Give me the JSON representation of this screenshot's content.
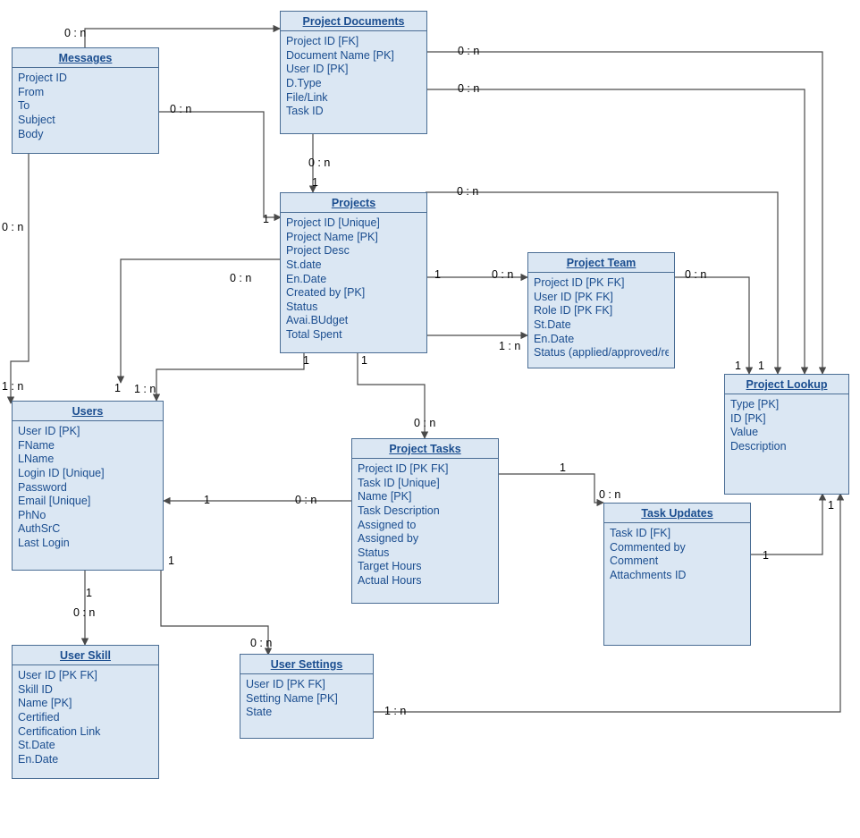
{
  "entities": {
    "messages": {
      "title": "Messages",
      "attrs": [
        "Project ID",
        "From",
        "To",
        "Subject",
        "Body"
      ]
    },
    "projectDocuments": {
      "title": "Project Documents",
      "attrs": [
        "Project ID [FK]",
        "Document Name [PK]",
        "User ID [PK]",
        "D.Type",
        "File/Link",
        "Task ID"
      ]
    },
    "projects": {
      "title": "Projects",
      "attrs": [
        "Project ID [Unique]",
        "Project Name [PK]",
        "Project Desc",
        "St.date",
        "En.Date",
        "Created by [PK]",
        "Status",
        "Avai.BUdget",
        "Total Spent"
      ]
    },
    "projectTeam": {
      "title": "Project Team",
      "attrs": [
        "Project ID [PK FK]",
        "User ID [PK FK]",
        "Role ID [PK FK]",
        "St.Date",
        "En.Date",
        "Status (applied/approved/rej"
      ]
    },
    "users": {
      "title": "Users",
      "attrs": [
        "User ID [PK]",
        "FName",
        "LName",
        "Login ID [Unique]",
        "Password",
        "Email  [Unique]",
        "PhNo",
        "AuthSrC",
        "Last Login"
      ]
    },
    "projectTasks": {
      "title": "Project Tasks",
      "attrs": [
        "Project ID [PK FK]",
        "Task ID [Unique]",
        "Name [PK]",
        "Task Description",
        "Assigned to",
        "Assigned by",
        "Status",
        "Target Hours",
        "Actual Hours"
      ]
    },
    "projectLookup": {
      "title": "Project Lookup",
      "attrs": [
        "Type [PK]",
        "ID [PK]",
        "Value",
        "Description"
      ]
    },
    "taskUpdates": {
      "title": "Task Updates",
      "attrs": [
        "Task ID [FK]",
        "Commented by",
        "Comment",
        "Attachments ID"
      ]
    },
    "userSettings": {
      "title": "User Settings",
      "attrs": [
        "User ID [PK FK]",
        "Setting Name [PK]",
        "State"
      ]
    },
    "userSkill": {
      "title": "User Skill",
      "attrs": [
        "User ID [PK FK]",
        "Skill ID",
        "Name [PK]",
        "Certified",
        "Certification Link",
        "St.Date",
        "En.Date"
      ]
    }
  },
  "labels": {
    "l1": "0 : n",
    "l2": "0 : n",
    "l3": "0 : n",
    "l4": "0 : n",
    "l5": "0 : n",
    "l6": "1",
    "l7": "1",
    "l8": "0 : n",
    "l9": "0 : n",
    "l10": "0 : n",
    "l11": "1",
    "l12": "0 : n",
    "l13": "1",
    "l14": "0 : n",
    "l15": "1 : n",
    "l16": "1",
    "l17": "1",
    "l18": "1",
    "l19": "1",
    "l20": "1 : n",
    "l21": "0 : n",
    "l22": "1",
    "l23": "0 : n",
    "l24": "1",
    "l25": "0 : n",
    "l26": "1",
    "l27": "1",
    "l28": "1",
    "l29": "0 : n",
    "l30": "0 : n",
    "l31": "1 : n",
    "l32": "1 : n",
    "l33": "1"
  }
}
